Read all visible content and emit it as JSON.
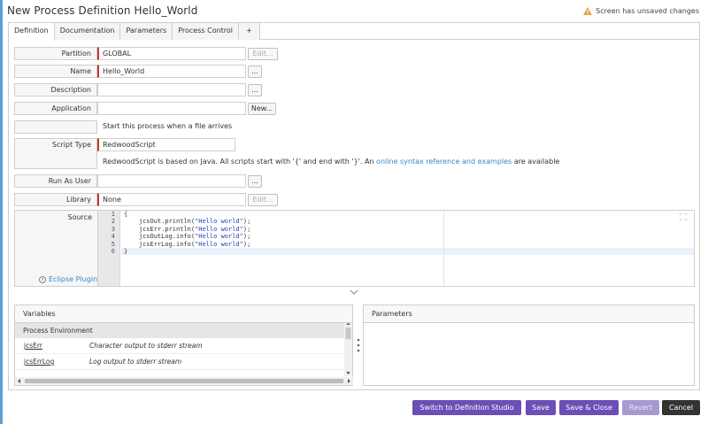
{
  "window": {
    "title": "New Process Definition Hello_World",
    "unsaved": "Screen has unsaved changes"
  },
  "tabs": [
    {
      "label": "Definition"
    },
    {
      "label": "Documentation"
    },
    {
      "label": "Parameters"
    },
    {
      "label": "Process Control"
    },
    {
      "label": "+"
    }
  ],
  "form": {
    "partition": {
      "label": "Partition",
      "value": "GLOBAL",
      "button": "Edit..."
    },
    "name": {
      "label": "Name",
      "value": "Hello_World",
      "button": "..."
    },
    "description": {
      "label": "Description",
      "value": "",
      "button": "..."
    },
    "application": {
      "label": "Application",
      "value": "",
      "button": "New..."
    },
    "file_arrival": {
      "link": "Start this process when a file arrives"
    },
    "script_type": {
      "label": "Script Type",
      "value": "RedwoodScript",
      "note_prefix": "RedwoodScript is based on Java. All scripts start with '{' and end with '}'. An ",
      "note_link": "online syntax reference and examples",
      "note_suffix": " are available"
    },
    "run_as_user": {
      "label": "Run As User",
      "value": "",
      "button": "..."
    },
    "library": {
      "label": "Library",
      "value": "None",
      "button": "Edit..."
    },
    "source": {
      "label": "Source",
      "eclipse_link": "Eclipse Plugin",
      "lines": [
        {
          "num": "1",
          "code": "{"
        },
        {
          "num": "2",
          "indent": "    ",
          "code": "jcsOut.println(",
          "str": "\"Hello world\"",
          "end": ");"
        },
        {
          "num": "3",
          "indent": "    ",
          "code": "jcsErr.println(",
          "str": "\"Hello world\"",
          "end": ");"
        },
        {
          "num": "4",
          "indent": "    ",
          "code": "jcsOutLog.info(",
          "str": "\"Hello world\"",
          "end": ");"
        },
        {
          "num": "5",
          "indent": "    ",
          "code": "jcsErrLog.info(",
          "str": "\"Hello world\"",
          "end": ");"
        },
        {
          "num": "6",
          "code": "}"
        }
      ]
    }
  },
  "variables": {
    "title": "Variables",
    "group": "Process Environment",
    "rows": [
      {
        "name": "jcsErr",
        "desc": "Character output to stderr stream"
      },
      {
        "name": "jcsErrLog",
        "desc": "Log output to stderr stream"
      }
    ]
  },
  "parameters_panel": {
    "title": "Parameters"
  },
  "footer": {
    "studio": "Switch to Definition Studio",
    "save": "Save",
    "save_close": "Save & Close",
    "revert": "Revert",
    "cancel": "Cancel"
  },
  "colors": {
    "accent": "#6a4fb6",
    "link": "#3a87c8",
    "required": "#c0392b"
  }
}
